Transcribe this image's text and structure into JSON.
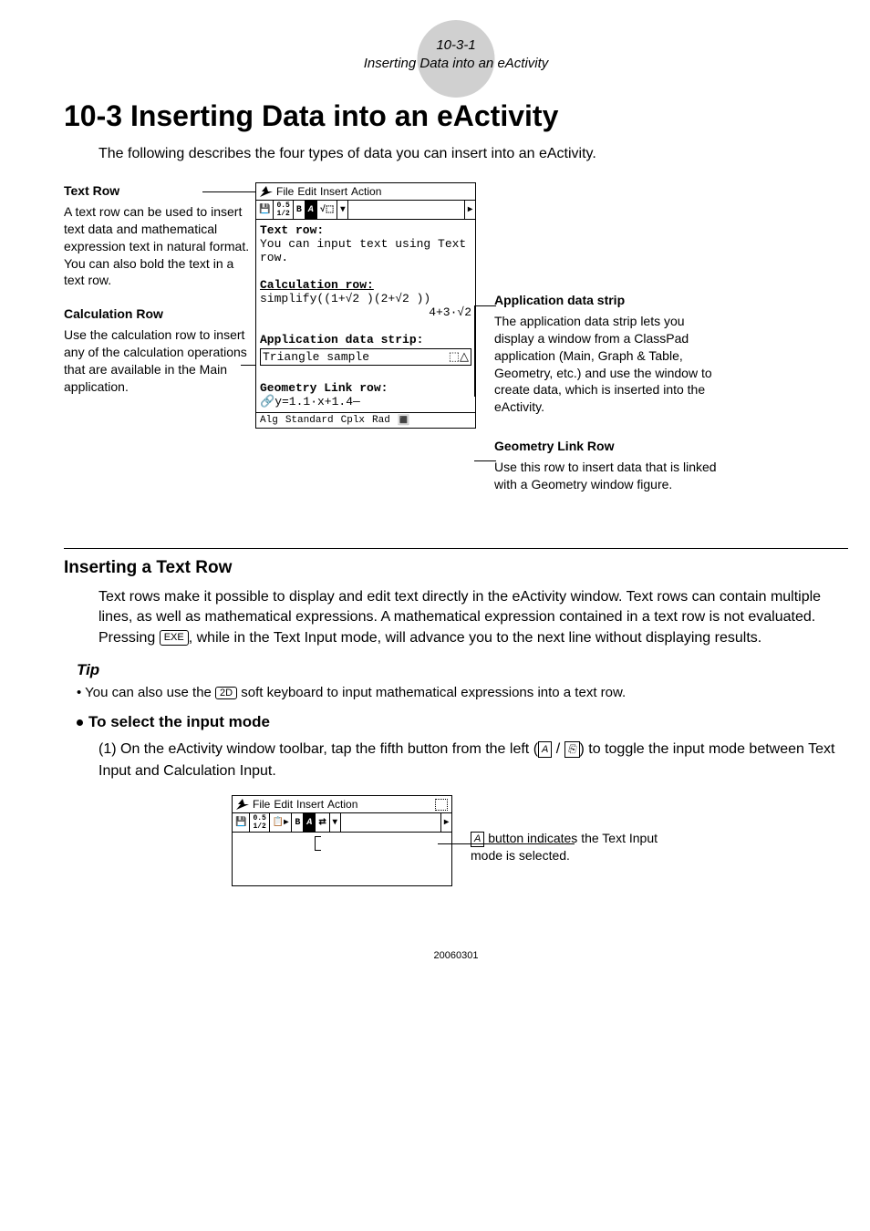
{
  "header": {
    "page": "10-3-1",
    "subtitle": "Inserting Data into an eActivity"
  },
  "title": "10-3 Inserting Data into an eActivity",
  "intro": "The following describes the four types of data you can insert into an eActivity.",
  "left": {
    "textrow": {
      "h": "Text Row",
      "p": "A text row can be used to insert text data and mathematical expression text in natural format. You can also bold the text in a text row."
    },
    "calcrow": {
      "h": "Calculation Row",
      "p": "Use the calculation row to insert any of the calculation operations that are available in the Main application."
    }
  },
  "right": {
    "appstrip": {
      "h": "Application data strip",
      "p": "The application data strip lets you display a window from a ClassPad application (Main, Graph & Table, Geometry, etc.) and use the window to create data, which is inserted into the eActivity."
    },
    "geolink": {
      "h": "Geometry Link Row",
      "p": "Use this row to insert data that is linked with a Geometry window figure."
    }
  },
  "screen1": {
    "menus": [
      "File",
      "Edit",
      "Insert",
      "Action"
    ],
    "text_row_h": "Text row:",
    "text_row_b": "You can input text using Text row.",
    "calc_row_h": "Calculation row:",
    "calc_row_b": "simplify((1+√2 )(2+√2 ))",
    "calc_row_r": "4+3·√2",
    "app_strip_h": "Application data strip:",
    "app_strip_b": "Triangle sample",
    "geo_link_h": "Geometry Link row:",
    "geo_link_b": "y=1.1·x+1.4",
    "status": {
      "a": "Alg",
      "b": "Standard",
      "c": "Cplx",
      "d": "Rad"
    }
  },
  "section2": {
    "h": "Inserting a Text Row",
    "body": "Text rows make it possible to display and edit text directly in the eActivity window. Text rows can contain multiple lines, as well as mathematical expressions. A mathematical expression contained in a text row is not evaluated.  Pressing ",
    "body2": ", while in the Text Input mode, will advance you to the next line without displaying results.",
    "exe": "EXE"
  },
  "tip": {
    "h": "Tip",
    "bullet": "You can also also use the ",
    "key": "2D",
    "bullet2": " soft keyboard to input mathematical expressions into a text row.",
    "bullet_fixed": "You can also use the "
  },
  "sub": {
    "h": "To select the input mode",
    "step": "(1) On the eActivity window toolbar, tap the fifth button from the left (",
    "step2": " / ",
    "step3": ") to toggle the input mode between Text Input and Calculation Input.",
    "iconA": "A",
    "iconB": "⎘"
  },
  "note": {
    "pre": "",
    "icon": "A",
    "text": " button indicates the Text Input mode is selected."
  },
  "footer": "20060301"
}
